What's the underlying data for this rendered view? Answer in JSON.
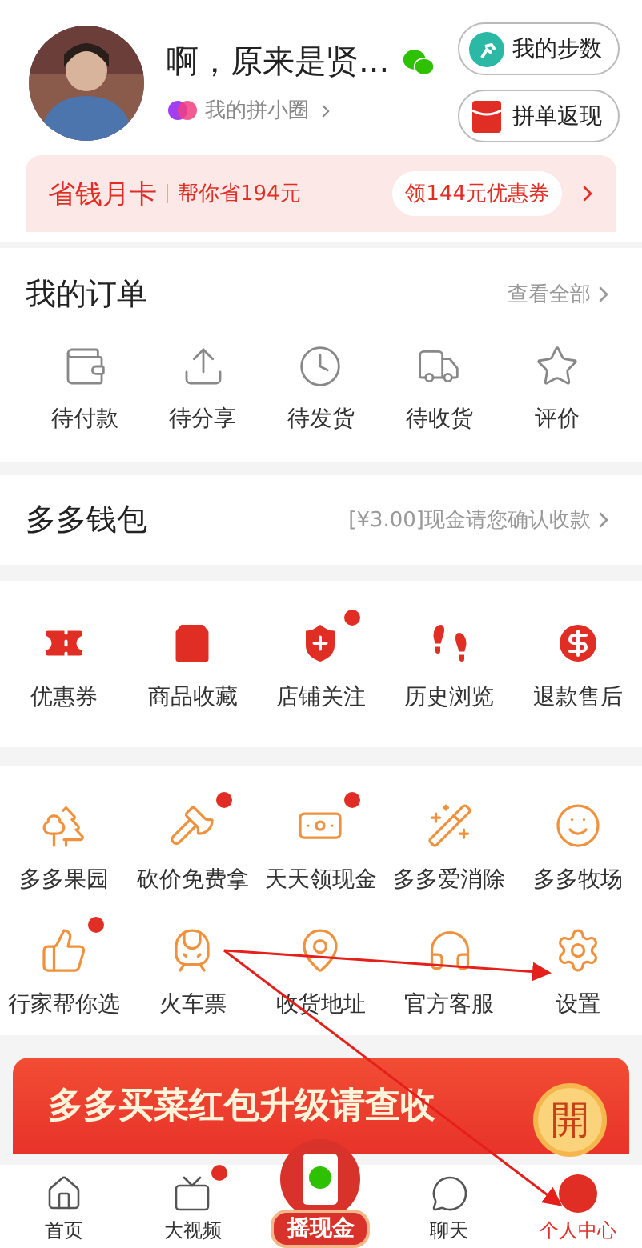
{
  "profile": {
    "name": "啊，原来是贤...",
    "circle_link": "我的拼小圈",
    "buttons": [
      "我的步数",
      "拼单返现"
    ]
  },
  "savings_card": {
    "title": "省钱月卡",
    "subtitle": "帮你省194元",
    "coupon": "领144元优惠券"
  },
  "orders": {
    "title": "我的订单",
    "view_all": "查看全部",
    "items": [
      "待付款",
      "待分享",
      "待发货",
      "待收货",
      "评价"
    ]
  },
  "wallet": {
    "title": "多多钱包",
    "note": "[¥3.00]现金请您确认收款"
  },
  "services": [
    {
      "label": "优惠券",
      "badge": false
    },
    {
      "label": "商品收藏",
      "badge": false
    },
    {
      "label": "店铺关注",
      "badge": true
    },
    {
      "label": "历史浏览",
      "badge": false
    },
    {
      "label": "退款售后",
      "badge": false
    }
  ],
  "tools": [
    {
      "label": "多多果园",
      "badge": false
    },
    {
      "label": "砍价免费拿",
      "badge": true
    },
    {
      "label": "天天领现金",
      "badge": true
    },
    {
      "label": "多多爱消除",
      "badge": false
    },
    {
      "label": "多多牧场",
      "badge": false
    },
    {
      "label": "行家帮你选",
      "badge": true
    },
    {
      "label": "火车票",
      "badge": false
    },
    {
      "label": "收货地址",
      "badge": false
    },
    {
      "label": "官方客服",
      "badge": false
    },
    {
      "label": "设置",
      "badge": false
    }
  ],
  "promo_banner": {
    "title": "多多买菜红包升级请查收",
    "seal": "開"
  },
  "bottom_nav": [
    {
      "label": "首页",
      "kind": "tab",
      "selected": false,
      "badge": false
    },
    {
      "label": "大视频",
      "kind": "tab",
      "selected": false,
      "badge": true
    },
    {
      "label": "摇现金",
      "kind": "feature",
      "selected": false
    },
    {
      "label": "聊天",
      "kind": "tab",
      "selected": false,
      "badge": false
    },
    {
      "label": "个人中心",
      "kind": "tab",
      "selected": true,
      "badge": false
    }
  ]
}
